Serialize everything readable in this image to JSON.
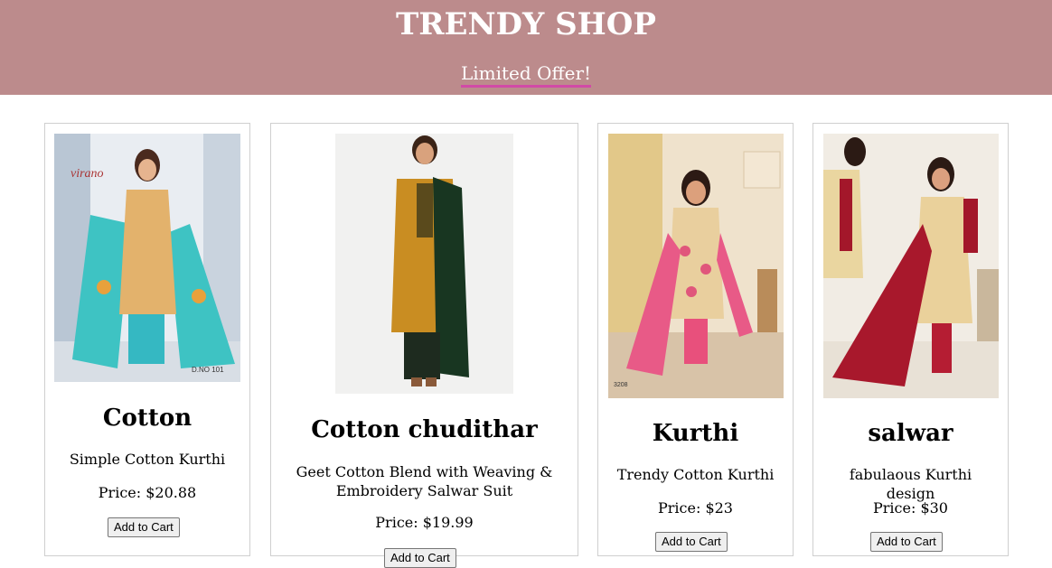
{
  "header": {
    "title": "TRENDY SHOP",
    "offer_link": "Limited Offer!"
  },
  "products": [
    {
      "name": "Cotton",
      "description": "Simple Cotton Kurthi",
      "price": "Price: $20.88",
      "button": "Add to Cart",
      "image_label": "D.NO 101",
      "brand": "virano"
    },
    {
      "name": "Cotton chudithar",
      "description": "Geet Cotton Blend with Weaving & Embroidery Salwar Suit",
      "price": "Price: $19.99",
      "button": "Add to Cart"
    },
    {
      "name": "Kurthi",
      "description": "Trendy Cotton Kurthi",
      "price": "Price: $23",
      "button": "Add to Cart",
      "image_label": "3208"
    },
    {
      "name": "salwar",
      "description": "fabulaous Kurthi design",
      "price": "Price: $30",
      "button": "Add to Cart"
    }
  ],
  "colors": {
    "header_bg": "#bc8b8c",
    "offer_underline": "#d24aa7",
    "card_border": "#cfcfcf"
  }
}
